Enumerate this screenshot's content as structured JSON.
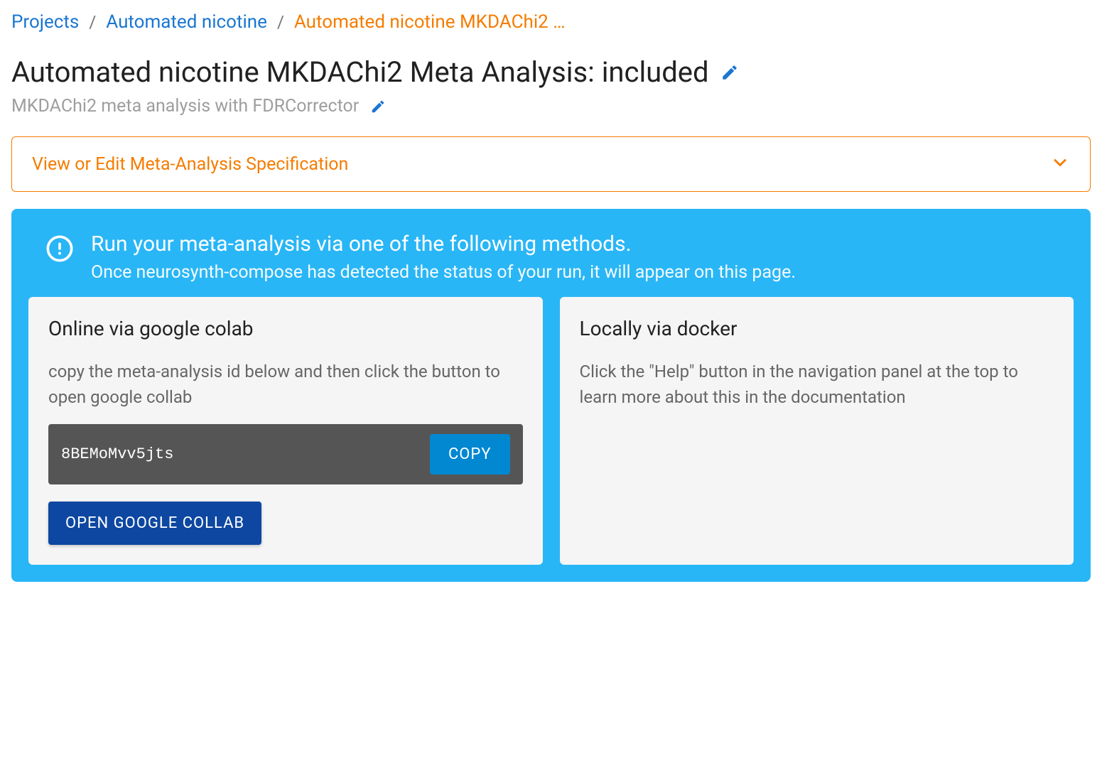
{
  "breadcrumb": {
    "items": [
      {
        "label": "Projects"
      },
      {
        "label": "Automated nicotine"
      },
      {
        "label": "Automated nicotine MKDAChi2 …"
      }
    ],
    "separator": "/"
  },
  "page": {
    "title": "Automated nicotine MKDAChi2 Meta Analysis: included",
    "subtitle": "MKDAChi2 meta analysis with FDRCorrector"
  },
  "accordion": {
    "label": "View or Edit Meta-Analysis Specification"
  },
  "info": {
    "title": "Run your meta-analysis via one of the following methods.",
    "subtitle": "Once neurosynth-compose has detected the status of your run, it will appear on this page."
  },
  "cards": {
    "colab": {
      "title": "Online via google colab",
      "text": "copy the meta-analysis id below and then click the button to open google collab",
      "id": "8BEMoMvv5jts",
      "copy_label": "COPY",
      "open_label": "OPEN GOOGLE COLLAB"
    },
    "docker": {
      "title": "Locally via docker",
      "text": "Click the \"Help\" button in the navigation panel at the top to learn more about this in the documentation"
    }
  }
}
